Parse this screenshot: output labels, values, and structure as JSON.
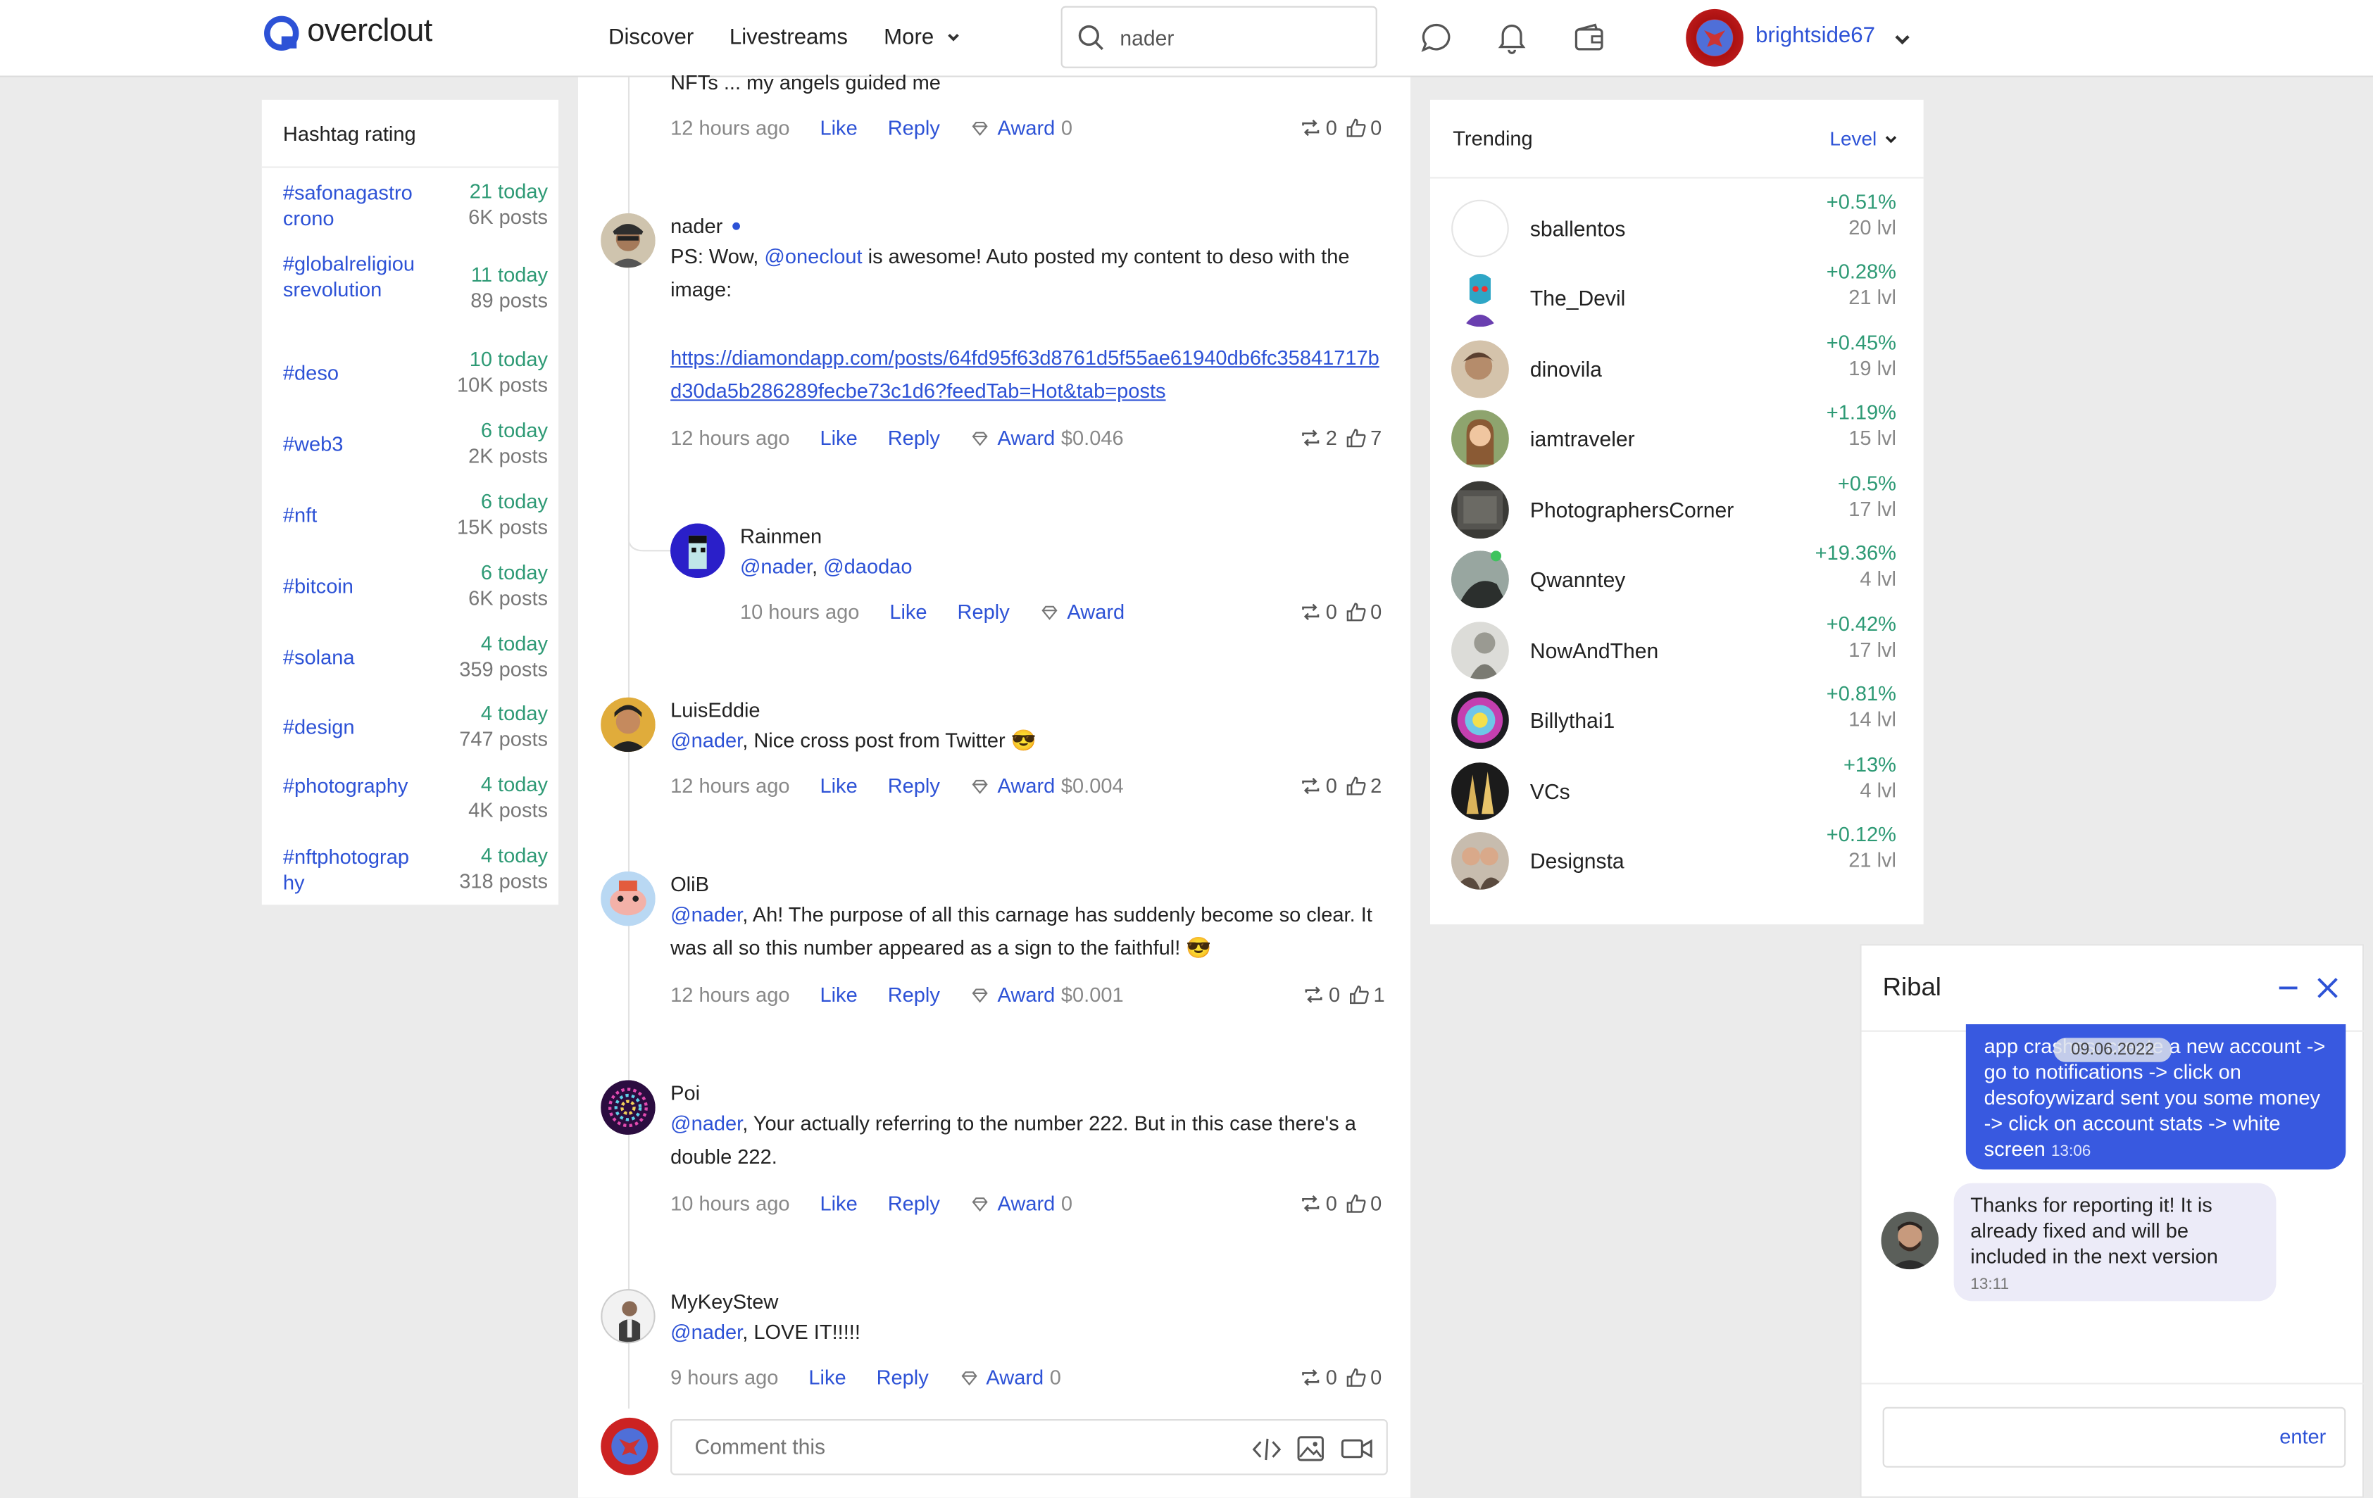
{
  "header": {
    "logo_text": "overclout",
    "nav": [
      "Discover",
      "Livestreams",
      "More"
    ],
    "search_value": "nader",
    "username": "brightside67"
  },
  "hashtags": {
    "title": "Hashtag rating",
    "items": [
      {
        "tag": "#safonagastrocrono",
        "today": "21 today",
        "posts": "6K posts"
      },
      {
        "tag": "#globalreligiousrevolution",
        "today": "11 today",
        "posts": "89 posts"
      },
      {
        "tag": "#deso",
        "today": "10 today",
        "posts": "10K posts"
      },
      {
        "tag": "#web3",
        "today": "6 today",
        "posts": "2K posts"
      },
      {
        "tag": "#nft",
        "today": "6 today",
        "posts": "15K posts"
      },
      {
        "tag": "#bitcoin",
        "today": "6 today",
        "posts": "6K posts"
      },
      {
        "tag": "#solana",
        "today": "4 today",
        "posts": "359 posts"
      },
      {
        "tag": "#design",
        "today": "4 today",
        "posts": "747 posts"
      },
      {
        "tag": "#photography",
        "today": "4 today",
        "posts": "4K posts"
      },
      {
        "tag": "#nftphotography",
        "today": "4 today",
        "posts": "318 posts"
      }
    ]
  },
  "feed": {
    "actions": {
      "like": "Like",
      "reply": "Reply",
      "award": "Award"
    },
    "comments": [
      {
        "text": "NFTs ... my angels guided me",
        "time": "12 hours ago",
        "award": "0",
        "reposts": "0",
        "likes": "0"
      },
      {
        "author": "nader",
        "text_pre": "PS: Wow, ",
        "mention": "@oneclout",
        "text_post": " is awesome! Auto posted my content to deso with the image:",
        "link": "https://diamondapp.com/posts/64fd95f63d8761d5f55ae61940db6fc35841717bd30da5b286289fecbe73c1d6?feedTab=Hot&tab=posts",
        "time": "12 hours ago",
        "award": "$0.046",
        "reposts": "2",
        "likes": "7"
      },
      {
        "author": "Rainmen",
        "mention1": "@nader",
        "sep": ", ",
        "mention2": "@daodao",
        "time": "10 hours ago",
        "award": "",
        "reposts": "0",
        "likes": "0"
      },
      {
        "author": "LuisEddie",
        "mention": "@nader",
        "text": ", Nice cross post from Twitter 😎",
        "time": "12 hours ago",
        "award": "$0.004",
        "reposts": "0",
        "likes": "2"
      },
      {
        "author": "OliB",
        "mention": "@nader",
        "text": ", Ah! The purpose of all this carnage has suddenly become so clear. It was all so this number appeared as a sign to the faithful! 😎",
        "time": "12 hours ago",
        "award": "$0.001",
        "reposts": "0",
        "likes": "1"
      },
      {
        "author": "Poi",
        "mention": "@nader",
        "text": ", Your actually referring to the number 222. But in this case there's a double 222.",
        "time": "10 hours ago",
        "award": "0",
        "reposts": "0",
        "likes": "0"
      },
      {
        "author": "MyKeyStew",
        "mention": "@nader",
        "text": ", LOVE IT!!!!!",
        "time": "9 hours ago",
        "award": "0",
        "reposts": "0",
        "likes": "0"
      }
    ],
    "comment_placeholder": "Comment this"
  },
  "trending": {
    "title": "Trending",
    "filter": "Level",
    "items": [
      {
        "name": "sballentos",
        "pct": "+0.51%",
        "lvl": "20 lvl"
      },
      {
        "name": "The_Devil",
        "pct": "+0.28%",
        "lvl": "21 lvl"
      },
      {
        "name": "dinovila",
        "pct": "+0.45%",
        "lvl": "19 lvl"
      },
      {
        "name": "iamtraveler",
        "pct": "+1.19%",
        "lvl": "15 lvl"
      },
      {
        "name": "PhotographersCorner",
        "pct": "+0.5%",
        "lvl": "17 lvl"
      },
      {
        "name": "Qwanntey",
        "pct": "+19.36%",
        "lvl": "4 lvl"
      },
      {
        "name": "NowAndThen",
        "pct": "+0.42%",
        "lvl": "17 lvl"
      },
      {
        "name": "Billythai1",
        "pct": "+0.81%",
        "lvl": "14 lvl"
      },
      {
        "name": "VCs",
        "pct": "+13%",
        "lvl": "4 lvl"
      },
      {
        "name": "Designsta",
        "pct": "+0.12%",
        "lvl": "21 lvl"
      }
    ]
  },
  "chat": {
    "title": "Ribal",
    "date": "09.06.2022",
    "out_text": "app crashes: create a new account -> go to notifications -> click on desofoywizard sent you some money -> click on account stats -> white screen",
    "out_time": "13:06",
    "in_text": "Thanks for reporting it! It is already fixed and will be included in the next version",
    "in_time": "13:11",
    "enter_label": "enter"
  }
}
